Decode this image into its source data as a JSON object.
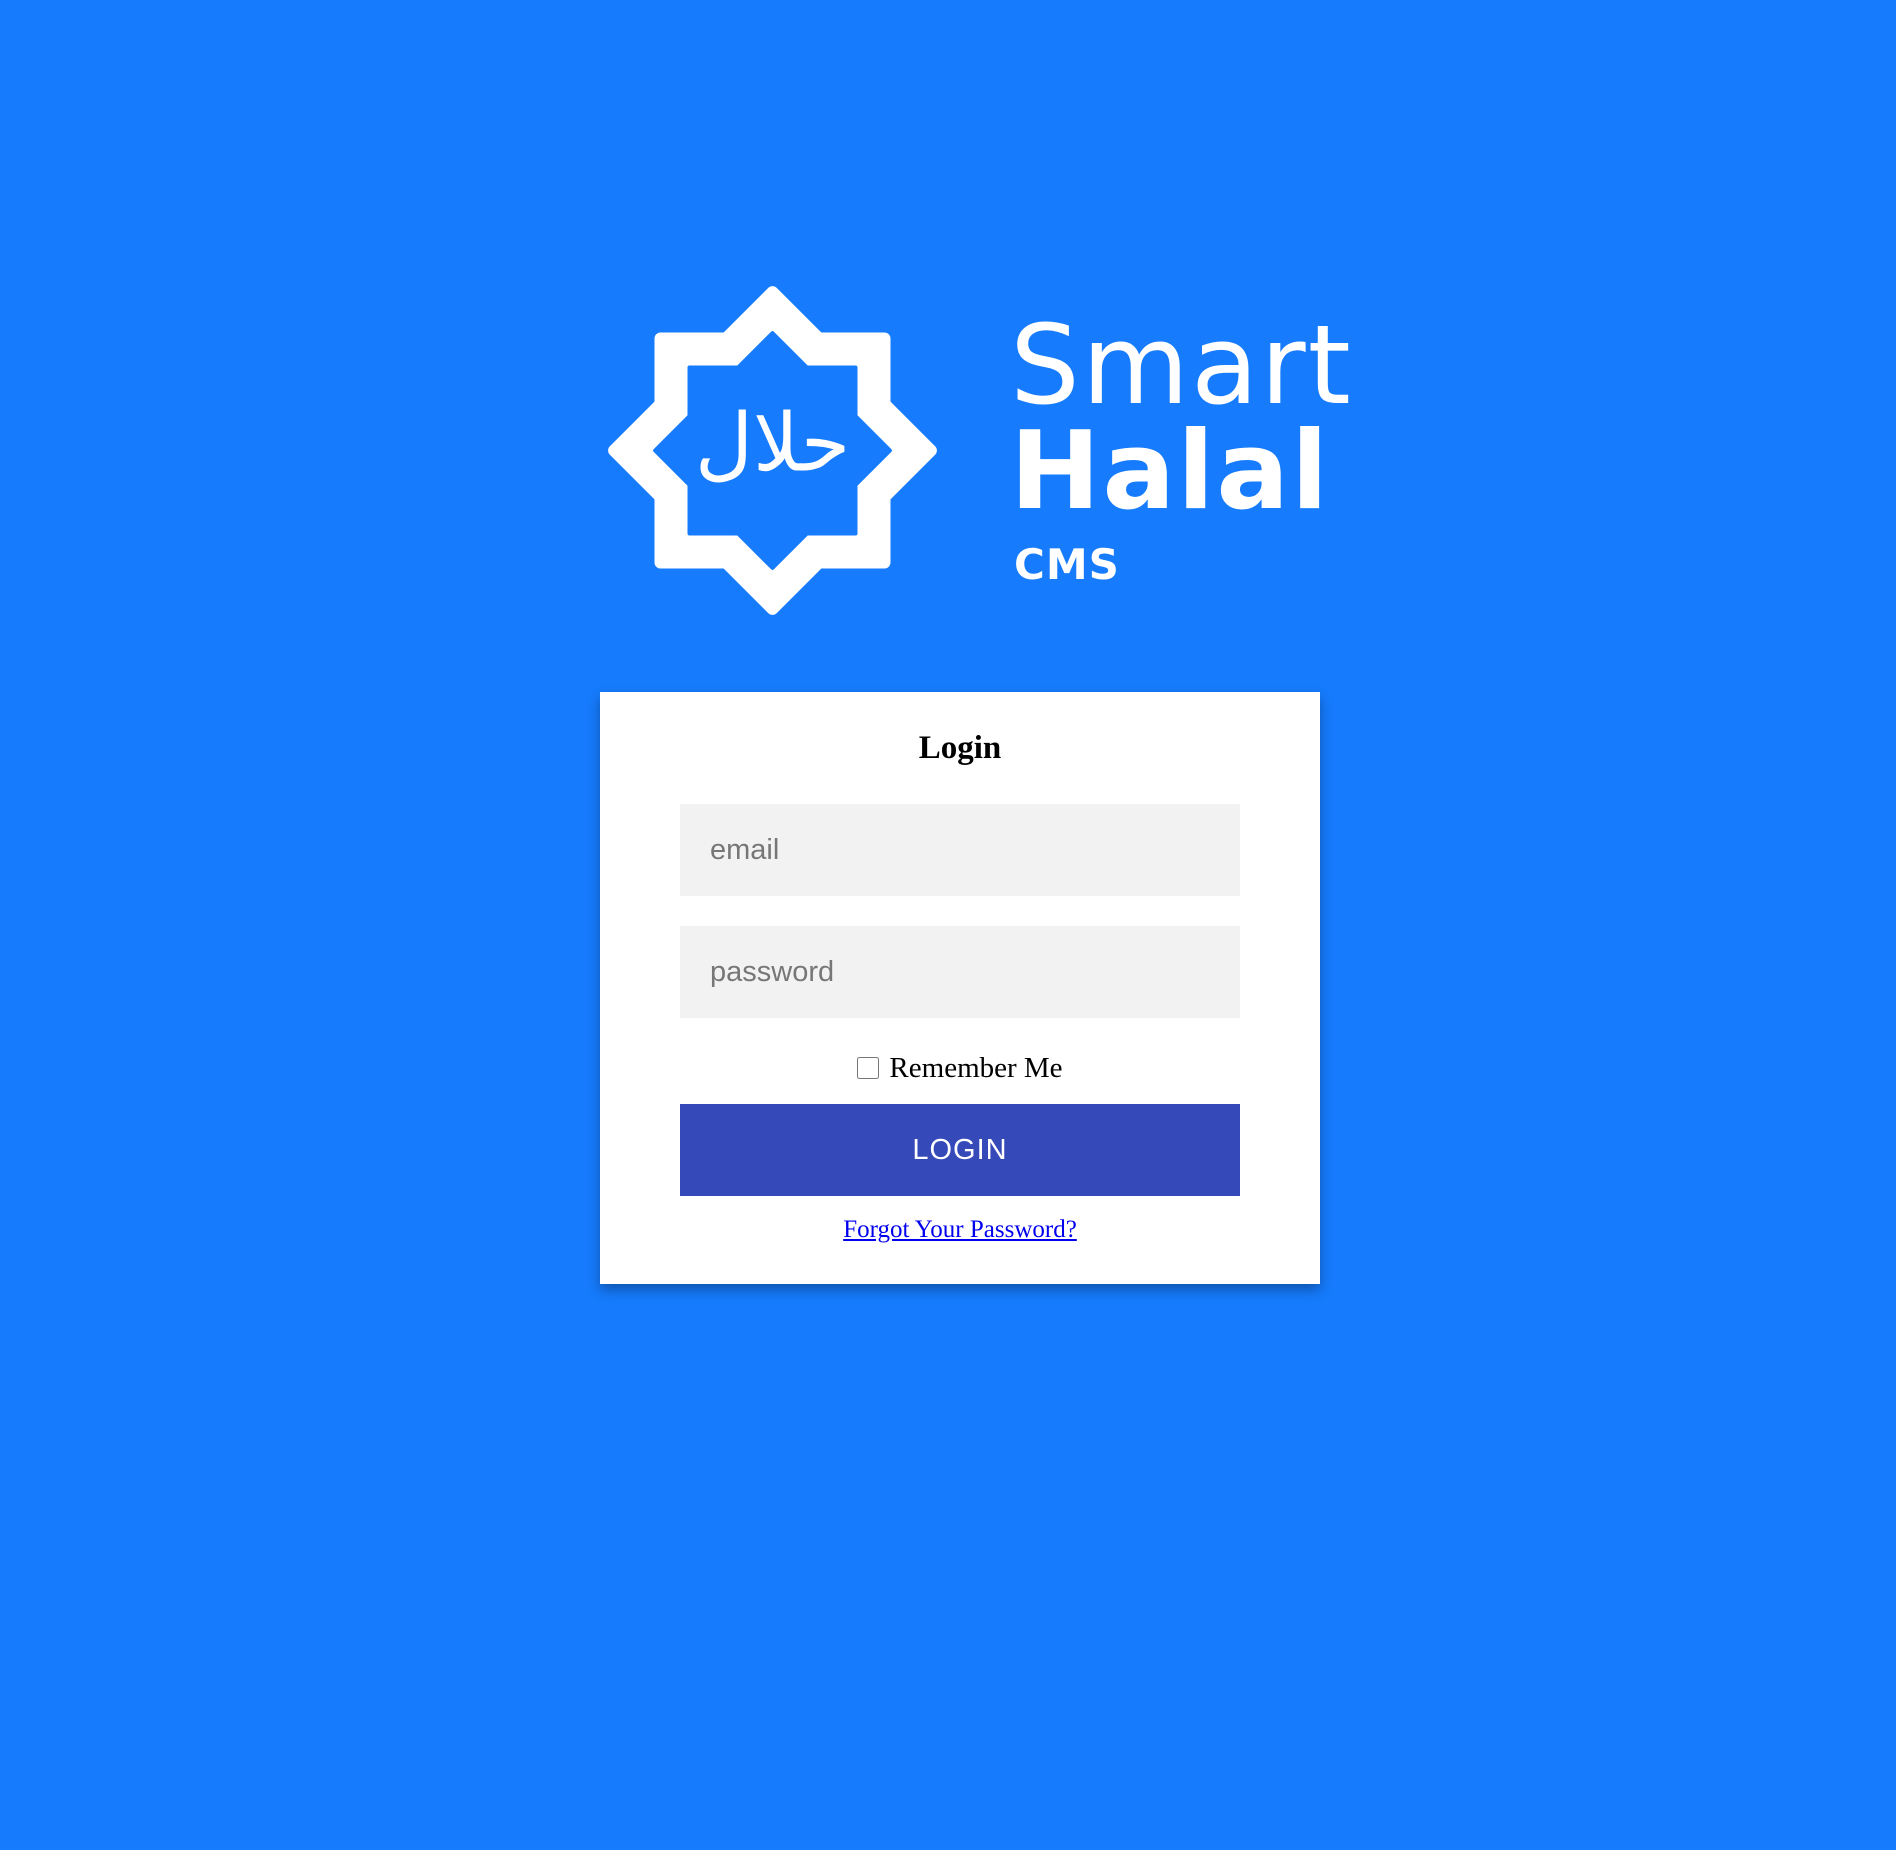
{
  "theme": {
    "background": "#167bfc",
    "logo_color": "#ffffff",
    "card_background": "#ffffff",
    "button_background": "#3549b8",
    "link_color": "#0000ee"
  },
  "logo": {
    "icon": "halal-star-emblem-icon",
    "emblem_text": "حلال",
    "line1": "Smart",
    "line2": "Halal",
    "line3": "CMS"
  },
  "login_form": {
    "title": "Login",
    "email_placeholder": "email",
    "password_placeholder": "password",
    "remember_label": "Remember Me",
    "remember_checked": false,
    "submit_label": "LOGIN",
    "forgot_password_label": "Forgot Your Password?"
  }
}
